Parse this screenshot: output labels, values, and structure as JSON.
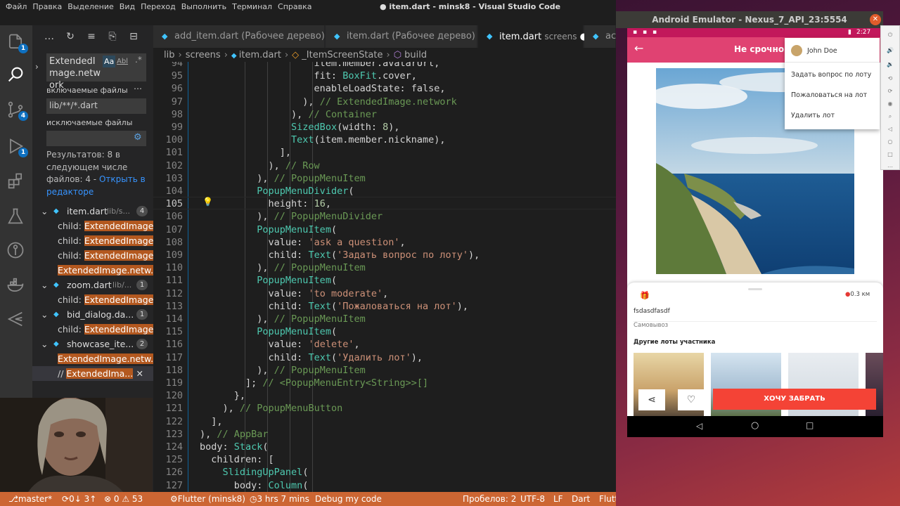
{
  "window": {
    "menu": [
      "Файл",
      "Правка",
      "Выделение",
      "Вид",
      "Переход",
      "Выполнить",
      "Терминал",
      "Справка"
    ],
    "title": "● item.dart - minsk8 - Visual Studio Code"
  },
  "activity_bar": {
    "badges": {
      "explorer": "1",
      "scm": "4",
      "debug": "1"
    }
  },
  "search": {
    "query": "ExtendedImage.network",
    "option_match_case": "Aa",
    "option_whole_word": "Abl",
    "include_label": "включаемые файлы",
    "include_value": "lib/**/*.dart",
    "exclude_label": "исключаемые файлы",
    "exclude_value": "",
    "results_text": "Результатов: 8 в следующем числе файлов: 4 - ",
    "open_in_editor": "Открыть в редакторе",
    "files": [
      {
        "name": "item.dart",
        "path": "lib/s...",
        "count": "4",
        "matches": [
          {
            "prefix": "child: ",
            "text": "ExtendedImage..."
          },
          {
            "prefix": "child: ",
            "text": "ExtendedImage..."
          },
          {
            "prefix": "child: ",
            "text": "ExtendedImage..."
          },
          {
            "prefix": "",
            "text": "ExtendedImage.netw..."
          }
        ]
      },
      {
        "name": "zoom.dart",
        "path": "lib/...",
        "count": "1",
        "matches": [
          {
            "prefix": "child: ",
            "text": "ExtendedImage..."
          }
        ]
      },
      {
        "name": "bid_dialog.da...",
        "path": "",
        "count": "1",
        "matches": [
          {
            "prefix": "child: ",
            "text": "ExtendedImage..."
          }
        ]
      },
      {
        "name": "showcase_ite...",
        "path": "",
        "count": "2",
        "matches": [
          {
            "prefix": "",
            "text": "ExtendedImage.netw..."
          },
          {
            "prefix": "// ",
            "text": "ExtendedIma..."
          }
        ]
      }
    ]
  },
  "tabs": [
    {
      "label": "add_item.dart (Рабочее дерево)"
    },
    {
      "label": "item.dart (Рабочее дерево)"
    },
    {
      "label": "item.dart",
      "sublabel": "screens",
      "modified": "●"
    },
    {
      "label": "ac"
    }
  ],
  "breadcrumb": [
    "lib",
    "screens",
    "item.dart",
    "_ItemScreenState",
    "build"
  ],
  "editor": {
    "lines": [
      {
        "n": "94",
        "t": "                    item.member.avatarUrl,"
      },
      {
        "n": "95",
        "t": "                    fit: BoxFit.cover,"
      },
      {
        "n": "96",
        "t": "                    enableLoadState: false,"
      },
      {
        "n": "97",
        "t": "                  ), // ExtendedImage.network"
      },
      {
        "n": "98",
        "t": "                ), // Container"
      },
      {
        "n": "99",
        "t": "                SizedBox(width: 8),"
      },
      {
        "n": "100",
        "t": "                Text(item.member.nickname),"
      },
      {
        "n": "101",
        "t": "              ],"
      },
      {
        "n": "102",
        "t": "            ), // Row"
      },
      {
        "n": "103",
        "t": "          ), // PopupMenuItem"
      },
      {
        "n": "104",
        "t": "          PopupMenuDivider("
      },
      {
        "n": "105",
        "t": "            height: 16,"
      },
      {
        "n": "106",
        "t": "          ), // PopupMenuDivider"
      },
      {
        "n": "107",
        "t": "          PopupMenuItem("
      },
      {
        "n": "108",
        "t": "            value: 'ask a question',"
      },
      {
        "n": "109",
        "t": "            child: Text('Задать вопрос по лоту'),"
      },
      {
        "n": "110",
        "t": "          ), // PopupMenuItem"
      },
      {
        "n": "111",
        "t": "          PopupMenuItem("
      },
      {
        "n": "112",
        "t": "            value: 'to moderate',"
      },
      {
        "n": "113",
        "t": "            child: Text('Пожаловаться на лот'),"
      },
      {
        "n": "114",
        "t": "          ), // PopupMenuItem"
      },
      {
        "n": "115",
        "t": "          PopupMenuItem("
      },
      {
        "n": "116",
        "t": "            value: 'delete',"
      },
      {
        "n": "117",
        "t": "            child: Text('Удалить лот'),"
      },
      {
        "n": "118",
        "t": "          ), // PopupMenuItem"
      },
      {
        "n": "119",
        "t": "        ]; // <PopupMenuEntry<String>>[]"
      },
      {
        "n": "120",
        "t": "      },"
      },
      {
        "n": "121",
        "t": "    ), // PopupMenuButton"
      },
      {
        "n": "122",
        "t": "  ],"
      },
      {
        "n": "123",
        "t": "), // AppBar"
      },
      {
        "n": "124",
        "t": "body: Stack("
      },
      {
        "n": "125",
        "t": "  children: ["
      },
      {
        "n": "126",
        "t": "    SlidingUpPanel("
      },
      {
        "n": "127",
        "t": "      body: Column("
      }
    ]
  },
  "statusbar": {
    "branch": "master*",
    "sync": "0↓ 3↑",
    "problems": "⊗ 0 ⚠ 53",
    "flutter": "Flutter (minsk8)",
    "time": "3 hrs 7 mins",
    "debug": "Debug my code",
    "spaces": "Пробелов: 2",
    "encoding": "UTF-8",
    "eol": "LF",
    "language": "Dart",
    "flutter_short": "Flutt"
  },
  "emulator": {
    "title": "Android Emulator - Nexus_7_API_23:5554",
    "clock": "2:27",
    "appbar_title": "Не срочно",
    "popup": {
      "user": "John Doe",
      "items": [
        "Задать вопрос по лоту",
        "Пожаловаться на лот",
        "Удалить лот"
      ]
    },
    "distance": "0.3 км",
    "item_title": "fsdasdfasdf",
    "delivery": "Самовывоз",
    "other_lots": "Другие лоты участника",
    "cta": "ХОЧУ ЗАБРАТЬ"
  },
  "colors": {
    "statusbar": "#cc6633",
    "appbar": "#e04272",
    "cta": "#f44336"
  }
}
